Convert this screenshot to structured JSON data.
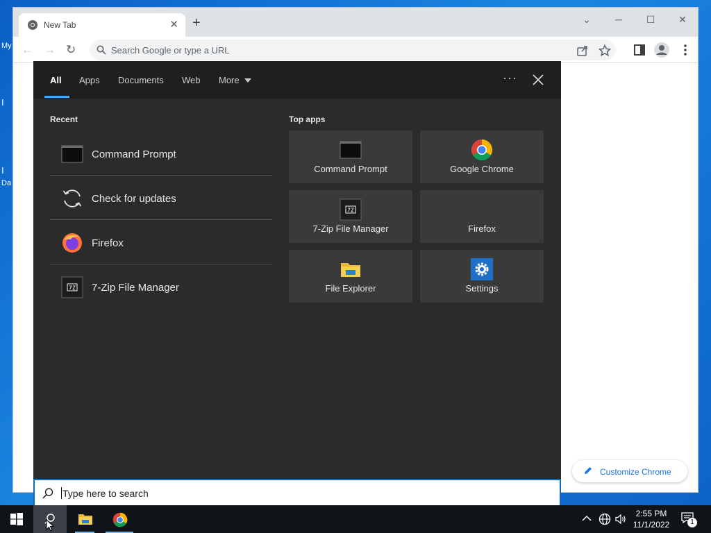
{
  "desktop": {
    "fragments": [
      "My",
      "I",
      "I",
      "Da"
    ]
  },
  "chrome": {
    "tab_title": "New Tab",
    "omnibox_placeholder": "Search Google or type a URL",
    "customize_label": "Customize Chrome"
  },
  "search": {
    "tabs": [
      {
        "label": "All",
        "active": true
      },
      {
        "label": "Apps"
      },
      {
        "label": "Documents"
      },
      {
        "label": "Web"
      },
      {
        "label": "More"
      }
    ],
    "recent_heading": "Recent",
    "recent": [
      {
        "label": "Command Prompt",
        "icon": "command-prompt-icon"
      },
      {
        "label": "Check for updates",
        "icon": "refresh-icon"
      },
      {
        "label": "Firefox",
        "icon": "firefox-icon"
      },
      {
        "label": "7-Zip File Manager",
        "icon": "7zip-icon"
      }
    ],
    "top_apps_heading": "Top apps",
    "top_apps": [
      {
        "label": "Command Prompt",
        "icon": "command-prompt-icon"
      },
      {
        "label": "Google Chrome",
        "icon": "chrome-icon"
      },
      {
        "label": "7-Zip File Manager",
        "icon": "7zip-icon"
      },
      {
        "label": "Firefox",
        "icon": "none"
      },
      {
        "label": "File Explorer",
        "icon": "folder-icon"
      },
      {
        "label": "Settings",
        "icon": "gear-icon"
      }
    ],
    "box_placeholder": "Type here to search"
  },
  "taskbar": {
    "time": "2:55 PM",
    "date": "11/1/2022",
    "notification_count": "1"
  },
  "colors": {
    "accent": "#0f6cbd",
    "panel_bg": "#2b2b2b",
    "tile_bg": "#3a3a3a",
    "chrome_blue": "#1a73e8"
  }
}
